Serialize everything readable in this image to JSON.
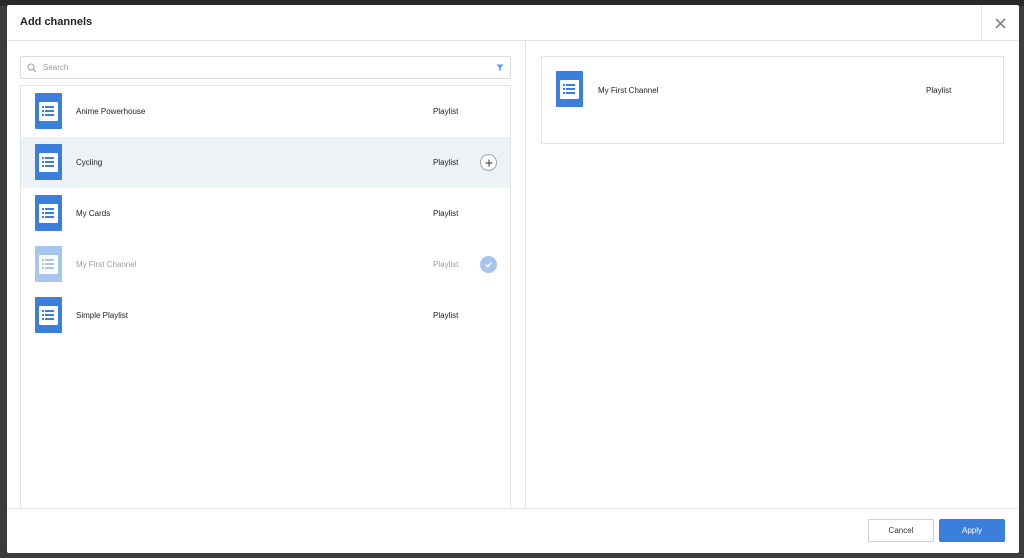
{
  "modal": {
    "title": "Add channels",
    "close_icon": "close-icon"
  },
  "search": {
    "placeholder": "Search",
    "value": ""
  },
  "channels": [
    {
      "name": "Anime Powerhouse",
      "type": "Playlist",
      "state": "normal"
    },
    {
      "name": "Cycling",
      "type": "Playlist",
      "state": "hover"
    },
    {
      "name": "My Cards",
      "type": "Playlist",
      "state": "normal"
    },
    {
      "name": "My First Channel",
      "type": "Playlist",
      "state": "selected"
    },
    {
      "name": "Simple Playlist",
      "type": "Playlist",
      "state": "normal"
    }
  ],
  "selected": [
    {
      "name": "My First Channel",
      "type": "Playlist"
    }
  ],
  "footer": {
    "cancel_label": "Cancel",
    "apply_label": "Apply"
  },
  "colors": {
    "accent": "#3b7fdc",
    "hover_row": "#edf2f7"
  }
}
